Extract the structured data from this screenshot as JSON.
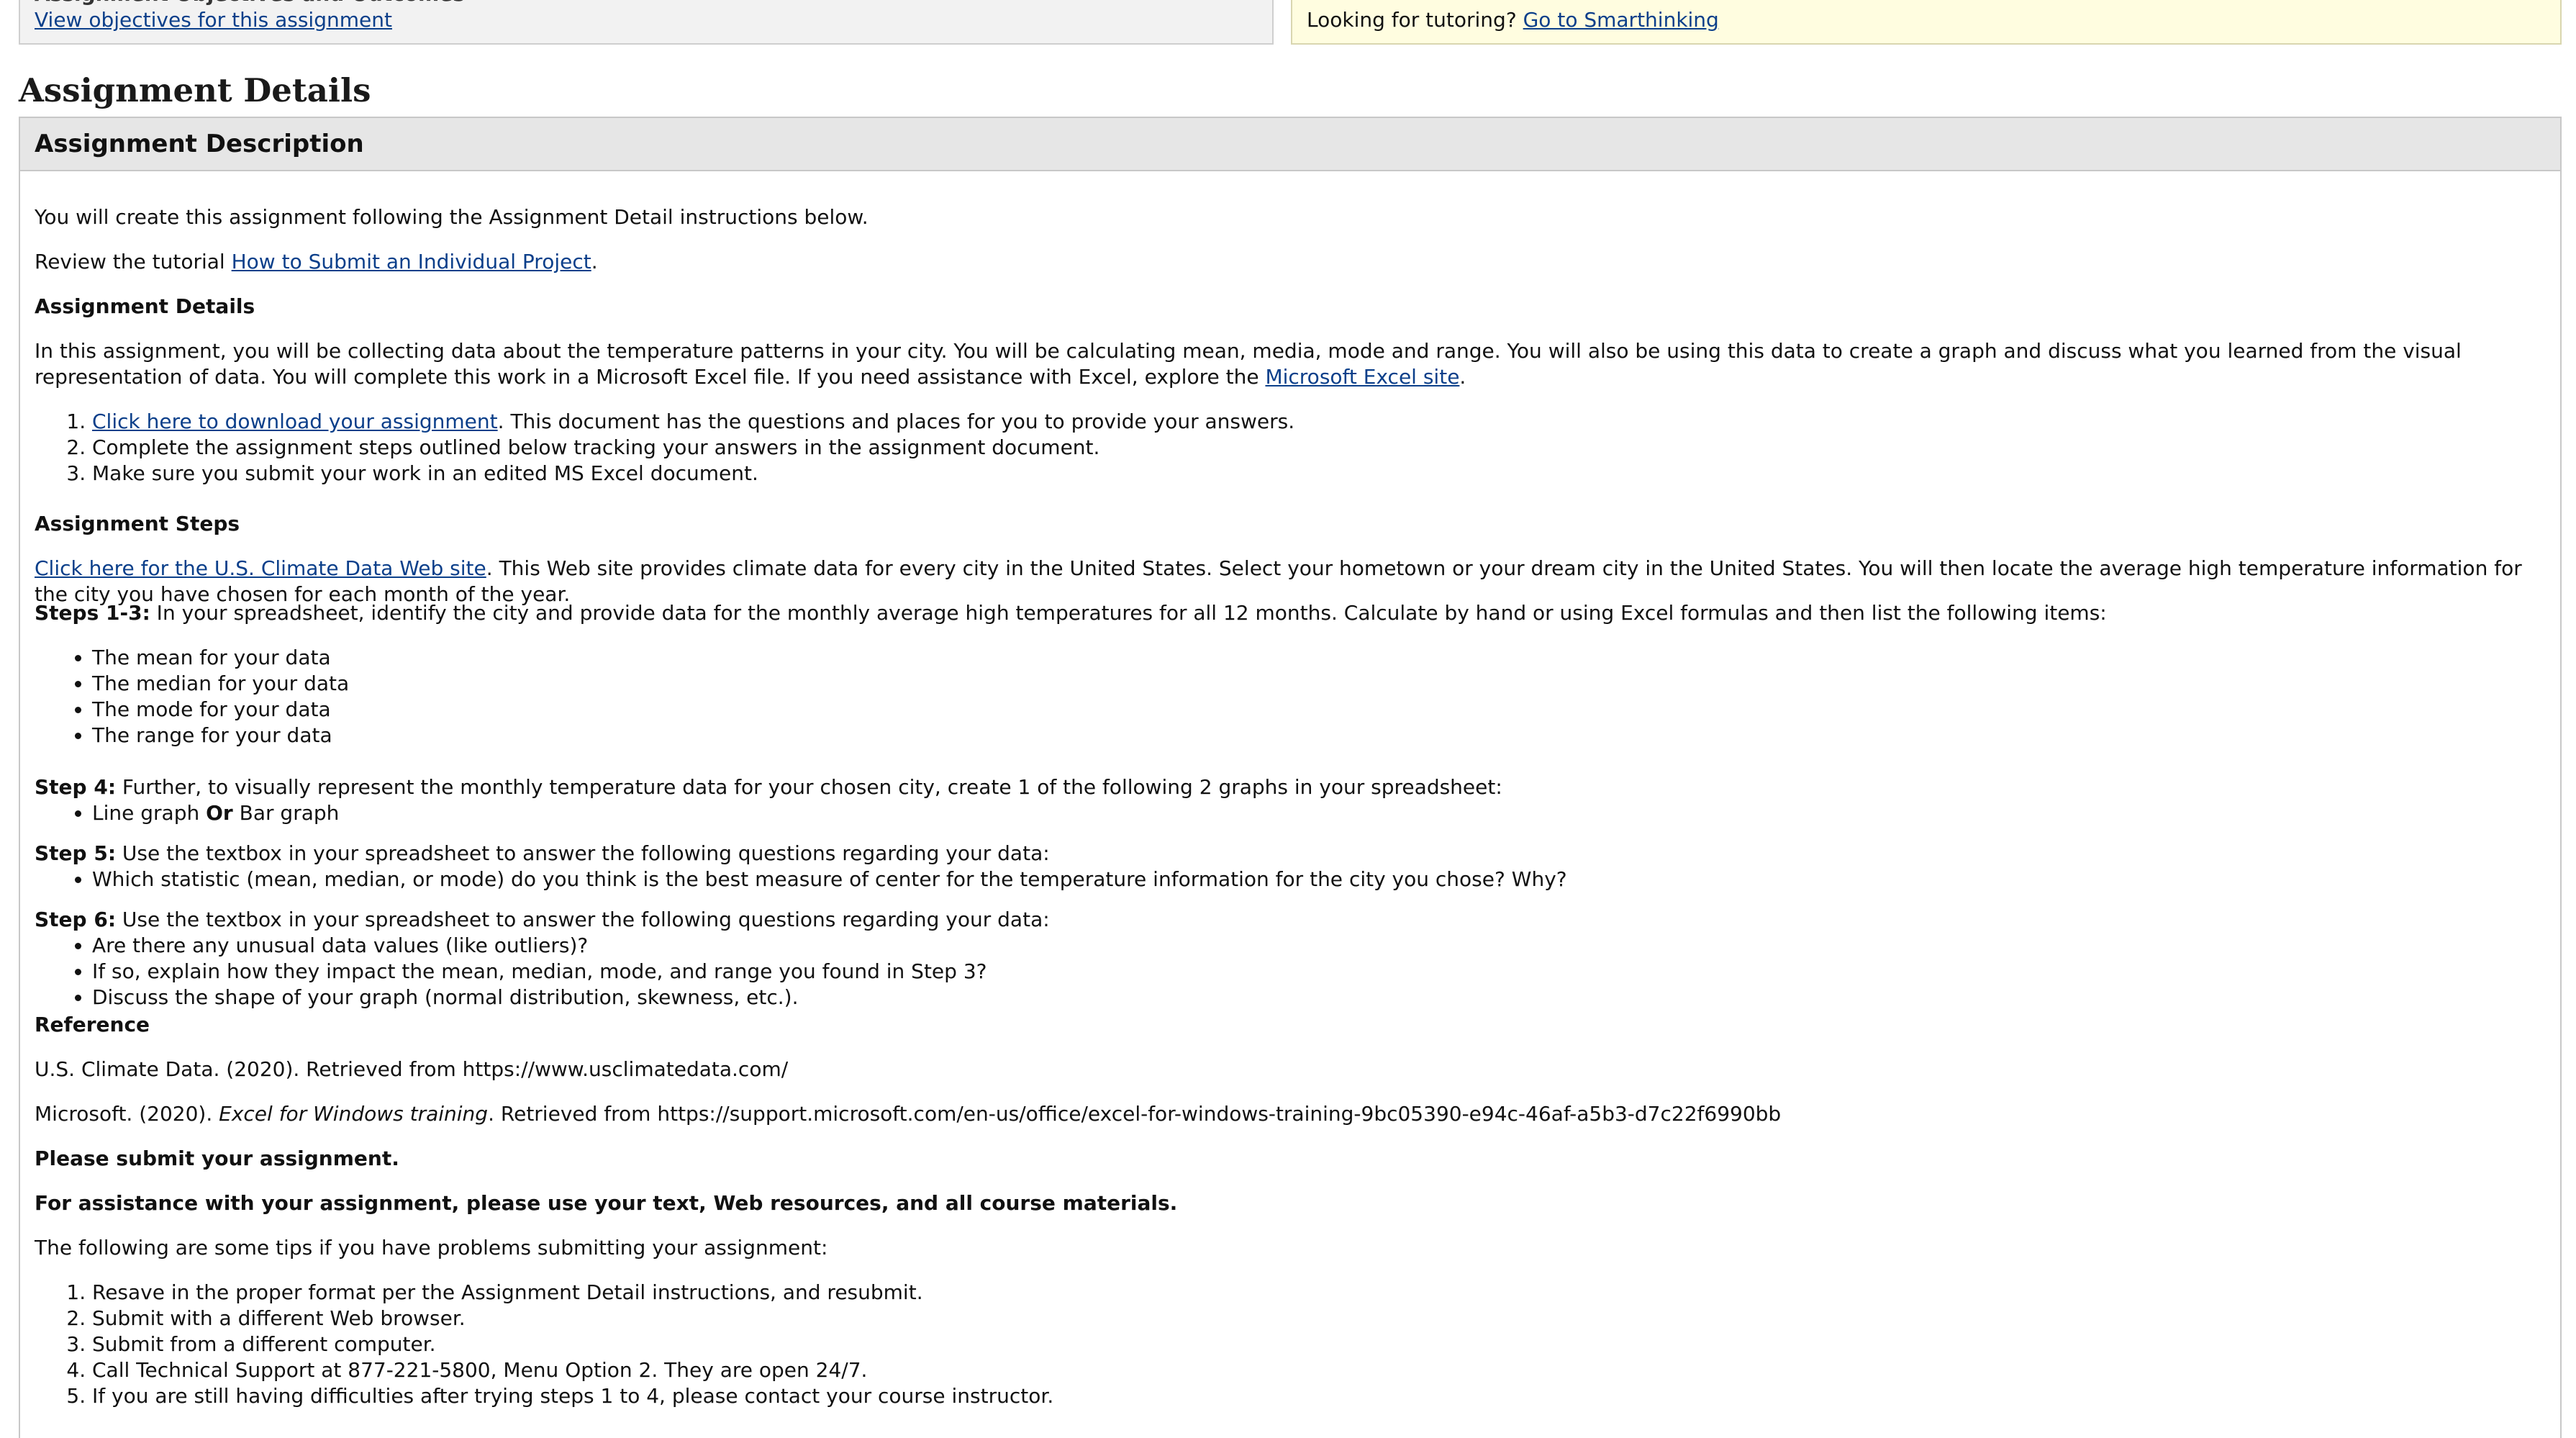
{
  "top": {
    "cutoff_text": "Assignment Objectives and Outcomes",
    "objectives_link": "View objectives for this assignment",
    "tutoring_prefix": "Looking for tutoring?",
    "tutoring_link": "Go to Smarthinking"
  },
  "section_title": "Assignment Details",
  "panel": {
    "header": "Assignment Description",
    "intro": "You will create this assignment following the Assignment Detail instructions below.",
    "tutorial_prefix": "Review the tutorial",
    "tutorial_link": "How to Submit an Individual Project",
    "tutorial_suffix": ".",
    "details_heading": "Assignment Details",
    "details_text": "In this assignment, you will be collecting data about the temperature patterns in your city. You will be calculating mean, media, mode and range. You will also be using this data to create a graph and discuss what you learned from the visual representation of data. You will complete this work in a Microsoft Excel file. If you need assistance with Excel, explore the",
    "excel_link": "Microsoft Excel site",
    "excel_suffix": ".",
    "steps_list": {
      "item1_link": "Click here to download your assignment",
      "item1_suffix": ". This document has the questions and places for you to provide your answers.",
      "item2": "Complete the assignment steps outlined below tracking your answers in the assignment document.",
      "item3": "Make sure you submit your work in an edited MS Excel document."
    },
    "steps_heading": "Assignment Steps",
    "climate_link": "Click here for the U.S. Climate Data Web site",
    "climate_text": ". This Web site provides climate data for every city in the United States. Select your hometown or your dream city in the United States. You will then locate the average high temperature information for the city you have chosen for each month of the year.",
    "steps13_label": "Steps 1-3:",
    "steps13_text": " In your spreadsheet, identify the city and provide data for the monthly average high temperatures for all 12 months. Calculate by hand or using Excel formulas and then list the following items:",
    "stats": [
      "The mean for your data",
      "The median for your data",
      "The mode for your data",
      "The range for your data"
    ],
    "step4_label": "Step 4:",
    "step4_text": " Further, to visually represent the monthly temperature data for your chosen city, create 1 of the following 2 graphs in your spreadsheet:",
    "step4_item_a": "Line graph ",
    "step4_item_or": "Or",
    "step4_item_b": " Bar graph",
    "step5_label": "Step 5:",
    "step5_text": " Use the textbox in your spreadsheet to answer the following questions regarding your data:",
    "step5_item": "Which statistic (mean, median, or mode) do you think is the best measure of center for the temperature information for the city you chose? Why?",
    "step6_label": "Step 6:",
    "step6_text": " Use the textbox in your spreadsheet to answer the following questions regarding your data:",
    "step6_items": [
      "Are there any unusual data values (like outliers)?",
      "If so, explain how they impact the mean, median, mode, and range you found in Step 3?",
      "Discuss the shape of your graph (normal distribution, skewness, etc.)."
    ],
    "reference_heading": "Reference",
    "ref1": "U.S. Climate Data. (2020). Retrieved from https://www.usclimatedata.com/",
    "ref2_prefix": "Microsoft. (2020). ",
    "ref2_italic": "Excel for Windows training",
    "ref2_suffix": ". Retrieved from https://support.microsoft.com/en-us/office/excel-for-windows-training-9bc05390-e94c-46af-a5b3-d7c22f6990bb",
    "submit_note": "Please submit your assignment.",
    "assist_note": "For assistance with your assignment, please use your text, Web resources, and all course materials.",
    "tips_intro": "The following are some tips if you have problems submitting your assignment:",
    "tips": [
      "Resave in the proper format per the Assignment Detail instructions, and resubmit.",
      "Submit with a different Web browser.",
      "Submit from a different computer.",
      "Call Technical Support at 877-221-5800, Menu Option 2. They are open 24/7.",
      "If you are still having difficulties after trying steps 1 to 4, please contact your course instructor."
    ]
  }
}
